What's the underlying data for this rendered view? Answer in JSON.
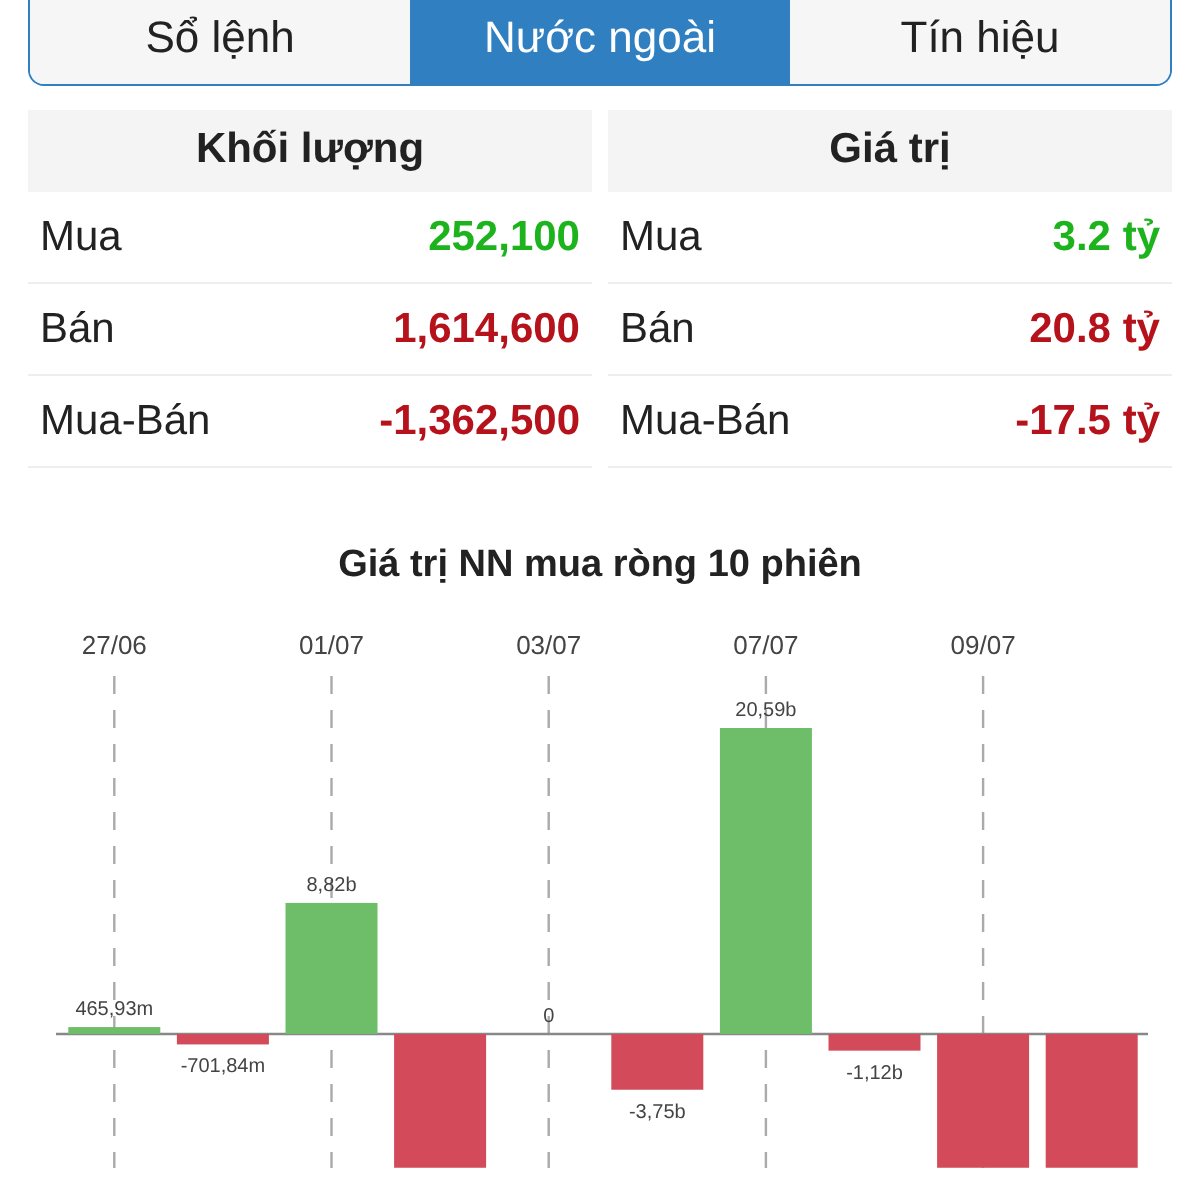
{
  "tabs": [
    {
      "label": "Sổ lệnh",
      "selected": false
    },
    {
      "label": "Nước ngoài",
      "selected": true
    },
    {
      "label": "Tín hiệu",
      "selected": false
    }
  ],
  "tables": [
    {
      "title": "Khối lượng",
      "rows": [
        {
          "label": "Mua",
          "value": "252,100",
          "kind": "up"
        },
        {
          "label": "Bán",
          "value": "1,614,600",
          "kind": "down"
        },
        {
          "label": "Mua-Bán",
          "value": "-1,362,500",
          "kind": "down"
        }
      ]
    },
    {
      "title": "Giá trị",
      "rows": [
        {
          "label": "Mua",
          "value": "3.2 tỷ",
          "kind": "up"
        },
        {
          "label": "Bán",
          "value": "20.8 tỷ",
          "kind": "down"
        },
        {
          "label": "Mua-Bán",
          "value": "-17.5 tỷ",
          "kind": "down"
        }
      ]
    }
  ],
  "chart": {
    "chart_data": {
      "type": "bar",
      "title": "Giá trị NN mua ròng 10 phiên",
      "categories": [
        "27/06",
        null,
        "01/07",
        null,
        "03/07",
        null,
        "07/07",
        null,
        "09/07",
        null
      ],
      "grid": true,
      "values": [
        465930000,
        -701840000,
        8820000000,
        -9000000000,
        0,
        -3750000000,
        20590000000,
        -1120000000,
        -9000000000,
        -9000000000
      ],
      "value_labels": [
        "465,93m",
        "-701,84m",
        "8,82b",
        null,
        "0",
        "-3,75b",
        "20,59b",
        "-1,12b",
        null,
        null
      ]
    }
  }
}
